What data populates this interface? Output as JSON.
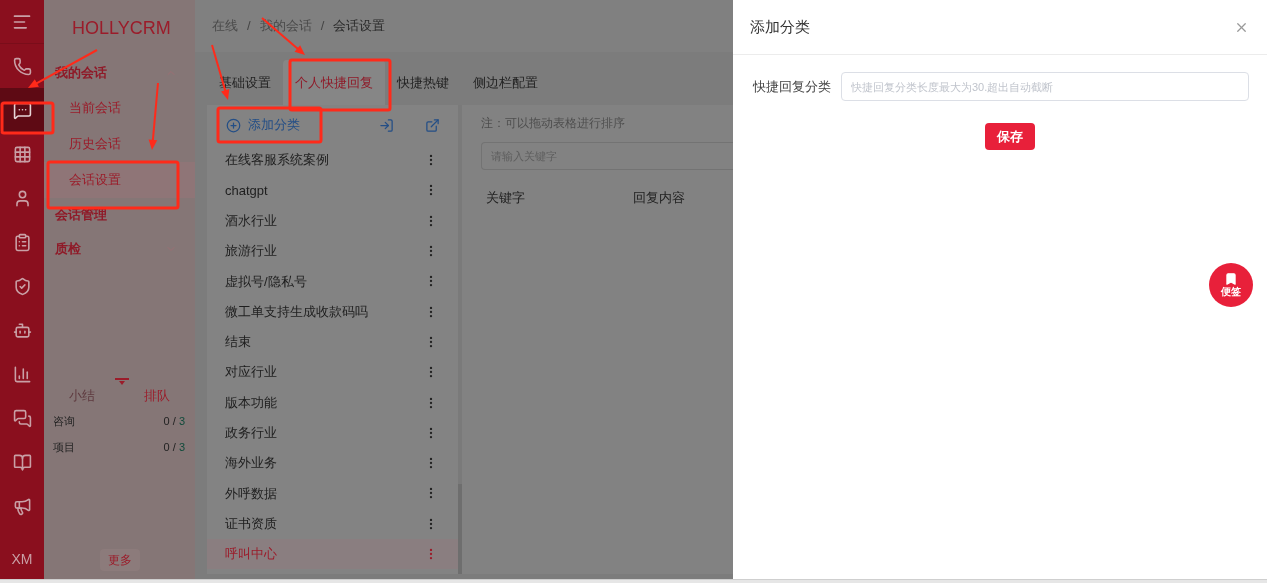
{
  "rail": {
    "items": [
      {
        "selected": false
      },
      {
        "selected": true
      },
      {
        "selected": false
      },
      {
        "selected": false
      },
      {
        "selected": false
      },
      {
        "selected": false
      },
      {
        "selected": false
      },
      {
        "selected": false
      },
      {
        "selected": false
      },
      {
        "selected": false
      },
      {
        "selected": false
      }
    ],
    "user": "XM"
  },
  "sidebar": {
    "brand": "HOLLYCRM",
    "menu": [
      {
        "label": "我的会话",
        "expanded": true,
        "children": [
          {
            "label": "当前会话",
            "selected": false
          },
          {
            "label": "历史会话",
            "selected": false
          },
          {
            "label": "会话设置",
            "selected": true
          }
        ]
      },
      {
        "label": "会话管理"
      },
      {
        "label": "质检",
        "expanded": false
      }
    ],
    "stats_tabs": [
      {
        "label": "小结",
        "selected": false
      },
      {
        "label": "排队",
        "selected": true
      }
    ],
    "stats": [
      {
        "label": "咨询",
        "count": "0 /",
        "limit": "3"
      },
      {
        "label": "项目",
        "count": "0 /",
        "limit": "3"
      }
    ],
    "more_button": "更多"
  },
  "breadcrumb": {
    "separator": "/",
    "items": [
      "在线",
      "我的会话",
      "会话设置"
    ]
  },
  "tabs": [
    {
      "label": "基础设置",
      "selected": false
    },
    {
      "label": "个人快捷回复",
      "selected": true
    },
    {
      "label": "快捷热键",
      "selected": false
    },
    {
      "label": "侧边栏配置",
      "selected": false
    }
  ],
  "categories": {
    "add_button": "添加分类",
    "items": [
      {
        "label": "在线客服系统案例",
        "selected": false
      },
      {
        "label": "chatgpt",
        "selected": false
      },
      {
        "label": "酒水行业",
        "selected": false
      },
      {
        "label": "旅游行业",
        "selected": false
      },
      {
        "label": "虚拟号/隐私号",
        "selected": false
      },
      {
        "label": "微工单支持生成收款码吗",
        "selected": false
      },
      {
        "label": "结束",
        "selected": false
      },
      {
        "label": "对应行业",
        "selected": false
      },
      {
        "label": "版本功能",
        "selected": false
      },
      {
        "label": "政务行业",
        "selected": false
      },
      {
        "label": "海外业务",
        "selected": false
      },
      {
        "label": "外呼数据",
        "selected": false
      },
      {
        "label": "证书资质",
        "selected": false
      },
      {
        "label": "呼叫中心",
        "selected": true
      }
    ]
  },
  "replies": {
    "note": "注：可以拖动表格进行排序",
    "search": {
      "placeholder": "请输入关键字"
    },
    "columns": [
      "关键字",
      "回复内容"
    ]
  },
  "drawer": {
    "title": "添加分类",
    "field": {
      "label": "快捷回复分类",
      "placeholder": "快捷回复分类长度最大为30.超出自动截断"
    },
    "save_button": "保存"
  },
  "floating_button": "便签"
}
